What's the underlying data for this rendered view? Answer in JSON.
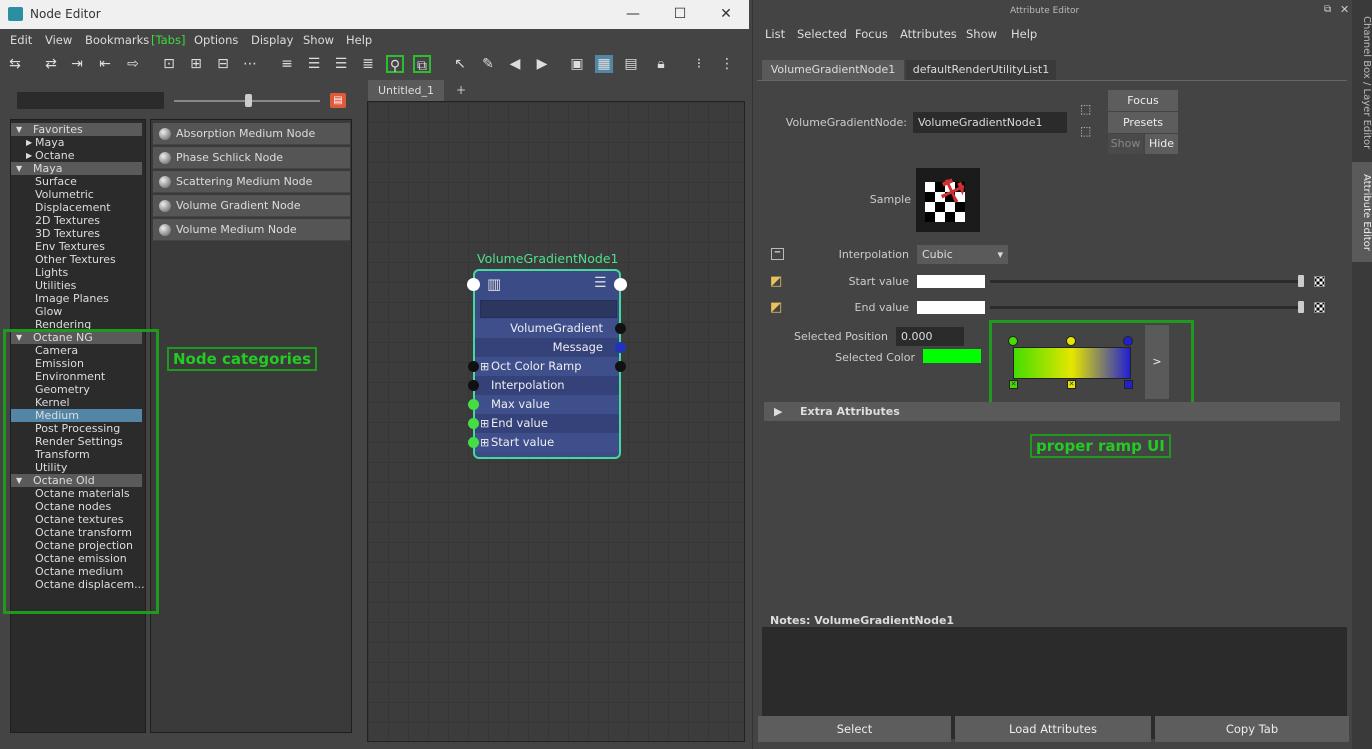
{
  "node_editor": {
    "title": "Node Editor",
    "window_controls": {
      "minimize": "—",
      "maximize": "☐",
      "close": "✕"
    },
    "menu": [
      "Edit",
      "View",
      "Bookmarks",
      "[Tabs]",
      "Options",
      "Display",
      "Show",
      "Help"
    ],
    "search_placeholder": "",
    "categories": [
      {
        "label": "Favorites",
        "type": "header",
        "arrow": "▼"
      },
      {
        "label": "Maya",
        "type": "sub",
        "arrow": "▶"
      },
      {
        "label": "Octane",
        "type": "sub",
        "arrow": "▶"
      },
      {
        "label": "Maya",
        "type": "header",
        "arrow": "▼"
      },
      {
        "label": "Surface",
        "type": "item"
      },
      {
        "label": "Volumetric",
        "type": "item"
      },
      {
        "label": "Displacement",
        "type": "item"
      },
      {
        "label": "2D Textures",
        "type": "item"
      },
      {
        "label": "3D Textures",
        "type": "item"
      },
      {
        "label": "Env Textures",
        "type": "item"
      },
      {
        "label": "Other Textures",
        "type": "item"
      },
      {
        "label": "Lights",
        "type": "item"
      },
      {
        "label": "Utilities",
        "type": "item"
      },
      {
        "label": "Image Planes",
        "type": "item"
      },
      {
        "label": "Glow",
        "type": "item"
      },
      {
        "label": "Rendering",
        "type": "item"
      },
      {
        "label": "Octane NG",
        "type": "header",
        "arrow": "▼"
      },
      {
        "label": "Camera",
        "type": "item"
      },
      {
        "label": "Emission",
        "type": "item"
      },
      {
        "label": "Environment",
        "type": "item"
      },
      {
        "label": "Geometry",
        "type": "item"
      },
      {
        "label": "Kernel",
        "type": "item"
      },
      {
        "label": "Medium",
        "type": "item",
        "selected": true
      },
      {
        "label": "Post Processing",
        "type": "item"
      },
      {
        "label": "Render Settings",
        "type": "item"
      },
      {
        "label": "Transform",
        "type": "item"
      },
      {
        "label": "Utility",
        "type": "item"
      },
      {
        "label": "Octane Old",
        "type": "header",
        "arrow": "▼"
      },
      {
        "label": "Octane materials",
        "type": "item"
      },
      {
        "label": "Octane nodes",
        "type": "item"
      },
      {
        "label": "Octane textures",
        "type": "item"
      },
      {
        "label": "Octane transform",
        "type": "item"
      },
      {
        "label": "Octane projection",
        "type": "item"
      },
      {
        "label": "Octane emission",
        "type": "item"
      },
      {
        "label": "Octane medium",
        "type": "item"
      },
      {
        "label": "Octane displacem...",
        "type": "item"
      }
    ],
    "node_list": [
      "Absorption Medium Node",
      "Phase Schlick Node",
      "Scattering Medium Node",
      "Volume Gradient Node",
      "Volume Medium Node"
    ],
    "annotation_categories": "Node categories",
    "canvas_tab": "Untitled_1",
    "canvas_tab_add": "+",
    "node": {
      "title": "VolumeGradientNode1",
      "rows": [
        {
          "label": "VolumeGradient",
          "align": "right",
          "right_port": "#111111",
          "left_port": null,
          "expand": false
        },
        {
          "label": "Message",
          "align": "right",
          "right_port": "#2233bb",
          "left_port": null,
          "expand": false
        },
        {
          "label": "Oct Color Ramp",
          "align": "left",
          "right_port": "#111111",
          "left_port": "#111111",
          "expand": true
        },
        {
          "label": "Interpolation",
          "align": "left",
          "right_port": null,
          "left_port": "#111111",
          "expand": false
        },
        {
          "label": "Max value",
          "align": "left",
          "right_port": null,
          "left_port": "#44dd44",
          "expand": false
        },
        {
          "label": "End value",
          "align": "left",
          "right_port": null,
          "left_port": "#44dd44",
          "expand": true
        },
        {
          "label": "Start value",
          "align": "left",
          "right_port": null,
          "left_port": "#44dd44",
          "expand": true
        }
      ]
    }
  },
  "attribute_editor": {
    "title": "Attribute Editor",
    "menu": [
      "List",
      "Selected",
      "Focus",
      "Attributes",
      "Show",
      "Help"
    ],
    "tabs": [
      "VolumeGradientNode1",
      "defaultRenderUtilityList1"
    ],
    "node_label": "VolumeGradientNode:",
    "node_value": "VolumeGradientNode1",
    "focus_btn": "Focus",
    "presets_btn": "Presets",
    "show_btn": "Show",
    "hide_btn": "Hide",
    "sample_label": "Sample",
    "interpolation_label": "Interpolation",
    "interpolation_value": "Cubic",
    "start_label": "Start value",
    "end_label": "End value",
    "selected_position_label": "Selected Position",
    "selected_position_value": "0.000",
    "selected_color_label": "Selected Color",
    "selected_color": "#00ff00",
    "ramp_expand": ">",
    "ramp_colors": [
      "#44dd00",
      "#e6e600",
      "#2020d0"
    ],
    "annotation_ramp": "proper ramp UI",
    "extra_attributes": "Extra Attributes",
    "notes_label": "Notes:  VolumeGradientNode1",
    "bottom_buttons": [
      "Select",
      "Load Attributes",
      "Copy Tab"
    ],
    "side_tabs": [
      "Channel Box / Layer Editor",
      "Attribute Editor"
    ]
  }
}
